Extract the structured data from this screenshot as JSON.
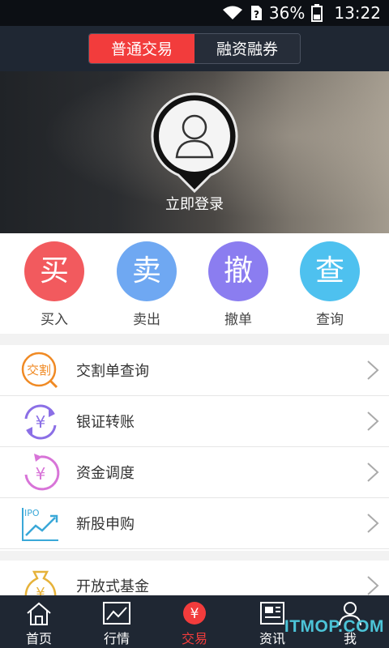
{
  "status_bar": {
    "battery": "36%",
    "time": "13:22",
    "sim_badge": "?"
  },
  "top_tabs": [
    {
      "label": "普通交易",
      "active": true
    },
    {
      "label": "融资融券",
      "active": false
    }
  ],
  "hero": {
    "login_label": "立即登录"
  },
  "quick_actions": [
    {
      "glyph": "买",
      "label": "买入",
      "color": "#f25a5e"
    },
    {
      "glyph": "卖",
      "label": "卖出",
      "color": "#6fa8f2"
    },
    {
      "glyph": "撤",
      "label": "撤单",
      "color": "#8b7df0"
    },
    {
      "glyph": "查",
      "label": "查询",
      "color": "#4ec1ef"
    }
  ],
  "menu": [
    {
      "label": "交割单查询",
      "icon_text": "交割",
      "icon": "delivery-icon"
    },
    {
      "label": "银证转账",
      "icon_text": "¥",
      "icon": "bank-transfer-icon"
    },
    {
      "label": "资金调度",
      "icon_text": "¥",
      "icon": "fund-dispatch-icon"
    },
    {
      "label": "新股申购",
      "icon_text": "IPO",
      "icon": "ipo-icon"
    }
  ],
  "menu2": [
    {
      "label": "开放式基金",
      "icon_text": "¥",
      "icon": "fund-bag-icon"
    }
  ],
  "tab_bar": [
    {
      "label": "首页",
      "icon": "home-icon",
      "active": false
    },
    {
      "label": "行情",
      "icon": "chart-icon",
      "active": false
    },
    {
      "label": "交易",
      "icon": "trade-icon",
      "icon_text": "¥",
      "active": true
    },
    {
      "label": "资讯",
      "icon": "news-icon",
      "active": false
    },
    {
      "label": "我",
      "icon": "user-icon",
      "active": false
    }
  ],
  "watermark": "ITMOP.COM"
}
